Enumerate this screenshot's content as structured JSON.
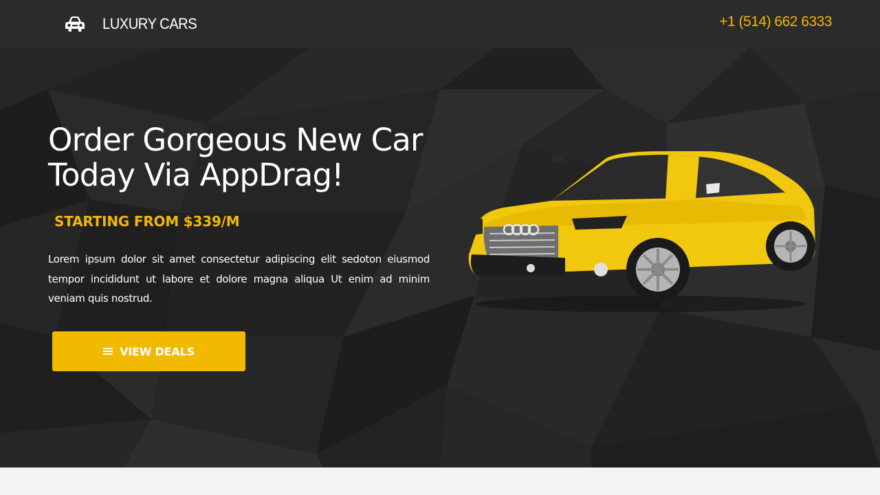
{
  "header": {
    "brand": "LUXURY CARS",
    "phone": "+1 (514) 662 6333",
    "logo_icon": "car-icon"
  },
  "hero": {
    "headline": "Order Gorgeous New Car Today Via AppDrag!",
    "price_line": "STARTING FROM $339/M",
    "description": "Lorem ipsum dolor sit amet consectetur adipiscing elit sedoton eiusmod tempor incididunt ut labore et dolore magna aliqua Ut enim ad minim veniam quis nostrud.",
    "cta_label": "VIEW DEALS",
    "cta_icon": "menu-icon",
    "image": "yellow-sedan-image"
  },
  "colors": {
    "accent": "#f1b900",
    "header_bg": "#2b2b2b",
    "hero_bg": "#1f1f1f",
    "text": "#ffffff",
    "footer_bg": "#f3f3f3"
  }
}
